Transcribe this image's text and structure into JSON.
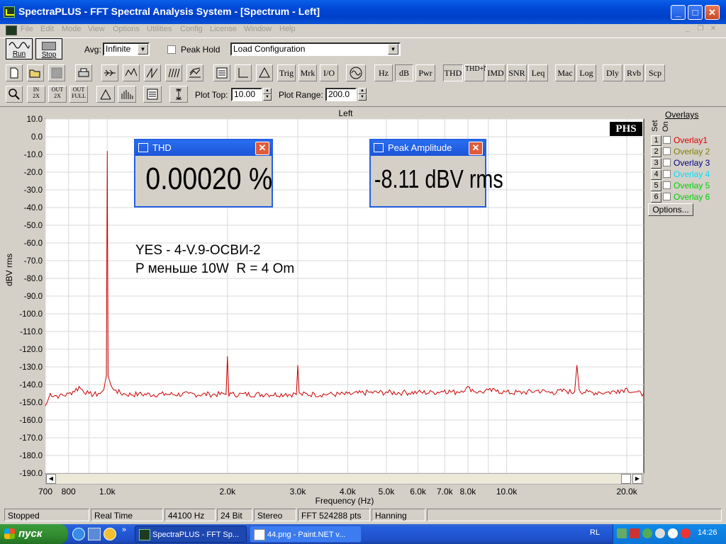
{
  "window": {
    "title": "SpectraPLUS - FFT Spectral Analysis System - [Spectrum - Left]",
    "minimize": "_",
    "maximize": "□",
    "close": "✕",
    "mdi_min": "_",
    "mdi_restore": "❐",
    "mdi_close": "✕"
  },
  "menu": [
    "File",
    "Edit",
    "Mode",
    "View",
    "Options",
    "Utilities",
    "Config",
    "License",
    "Window",
    "Help"
  ],
  "toolbar1": {
    "run_label": "Run",
    "stop_label": "Stop",
    "avg_label": "Avg:",
    "avg_value": "Infinite",
    "peak_hold_label": "Peak Hold",
    "peak_hold_checked": false,
    "load_config_value": "Load Configuration"
  },
  "toolbar2": {
    "text_buttons": [
      "Trig",
      "Mrk",
      "I/O",
      "Hz",
      "dB",
      "Pwr",
      "THD",
      "THD+N",
      "IMD",
      "SNR",
      "Leq",
      "Mac",
      "Log",
      "Dly",
      "Rvb",
      "Scp"
    ]
  },
  "toolbar3": {
    "plot_top_label": "Plot Top:",
    "plot_top_value": "10.00",
    "plot_range_label": "Plot Range:",
    "plot_range_value": "200.0"
  },
  "plot": {
    "channel_title": "Left",
    "logo": "PHS",
    "annotation_line1": "YES - 4-V.9-ОСВИ-2",
    "annotation_line2": "P меньше 10W  R = 4 Om",
    "line_color": "#cc0000"
  },
  "chart_data": {
    "type": "line",
    "title": "Left",
    "xlabel": "Frequency (Hz)",
    "ylabel": "dBV rms",
    "x_scale": "log",
    "xlim": [
      700,
      22050
    ],
    "ylim": [
      -190,
      10
    ],
    "grid": true,
    "y_ticks": [
      "10.0",
      "0.0",
      "-10.0",
      "-20.0",
      "-30.0",
      "-40.0",
      "-50.0",
      "-60.0",
      "-70.0",
      "-80.0",
      "-90.0",
      "-100.0",
      "-110.0",
      "-120.0",
      "-130.0",
      "-140.0",
      "-150.0",
      "-160.0",
      "-170.0",
      "-180.0",
      "-190.0"
    ],
    "x_ticks": [
      "700",
      "800",
      "1.0k",
      "2.0k",
      "3.0k",
      "4.0k",
      "5.0k",
      "6.0k",
      "7.0k",
      "8.0k",
      "10.0k",
      "20.0k"
    ],
    "series": [
      {
        "x": [
          700,
          720,
          760,
          800,
          850,
          900,
          950,
          980,
          995,
          1000,
          1005,
          1020,
          1050,
          1100,
          1200,
          1400,
          1600,
          1800,
          1950,
          2000,
          2050,
          2200,
          2500,
          2800,
          2950,
          3000,
          3050,
          3300,
          3600,
          4000,
          4500,
          5000,
          5500,
          6000,
          6500,
          7000,
          7500,
          8000,
          8500,
          9000,
          9500,
          10000,
          11000,
          12000,
          13000,
          14000,
          14800,
          15000,
          15200,
          16000,
          17000,
          18000,
          19000,
          20000,
          21000,
          22050
        ],
        "values": [
          -152,
          -145,
          -146,
          -145,
          -141,
          -145,
          -145,
          -143,
          -135,
          -8.1,
          -135,
          -140,
          -143,
          -145,
          -145,
          -145,
          -145,
          -145,
          -145,
          -124,
          -145,
          -145,
          -145,
          -145,
          -145,
          -129,
          -145,
          -145,
          -145,
          -145,
          -144,
          -144,
          -144,
          -144,
          -144,
          -143,
          -144,
          -141,
          -144,
          -143,
          -143,
          -144,
          -144,
          -143,
          -144,
          -143,
          -144,
          -129,
          -143,
          -144,
          -144,
          -144,
          -143,
          -142,
          -144,
          -145
        ]
      }
    ]
  },
  "thd_window": {
    "title": "THD",
    "value": "0.00020 %"
  },
  "peak_window": {
    "title": "Peak Amplitude",
    "value": "-8.11 dBV rms"
  },
  "overlays": {
    "title": "Overlays",
    "set_header": "Set",
    "on_header": "On",
    "items": [
      {
        "num": "1",
        "label": "Overlay1",
        "color": "#e00000"
      },
      {
        "num": "2",
        "label": "Overlay 2",
        "color": "#808000"
      },
      {
        "num": "3",
        "label": "Overlay 3",
        "color": "#000080"
      },
      {
        "num": "4",
        "label": "Overlay 4",
        "color": "#00e0ff"
      },
      {
        "num": "5",
        "label": "Overlay 5",
        "color": "#00d000"
      },
      {
        "num": "6",
        "label": "Overlay 6",
        "color": "#00d000"
      }
    ],
    "options_label": "Options..."
  },
  "status": [
    "Stopped",
    "Real Time",
    "44100 Hz",
    "24 Bit",
    "Stereo",
    "FFT 524288 pts",
    "Hanning"
  ],
  "taskbar": {
    "start_label": "пуск",
    "tasks": [
      "SpectraPLUS - FFT Sp...",
      "44.png - Paint.NET v..."
    ],
    "lang": "RL",
    "clock": "14:26"
  }
}
